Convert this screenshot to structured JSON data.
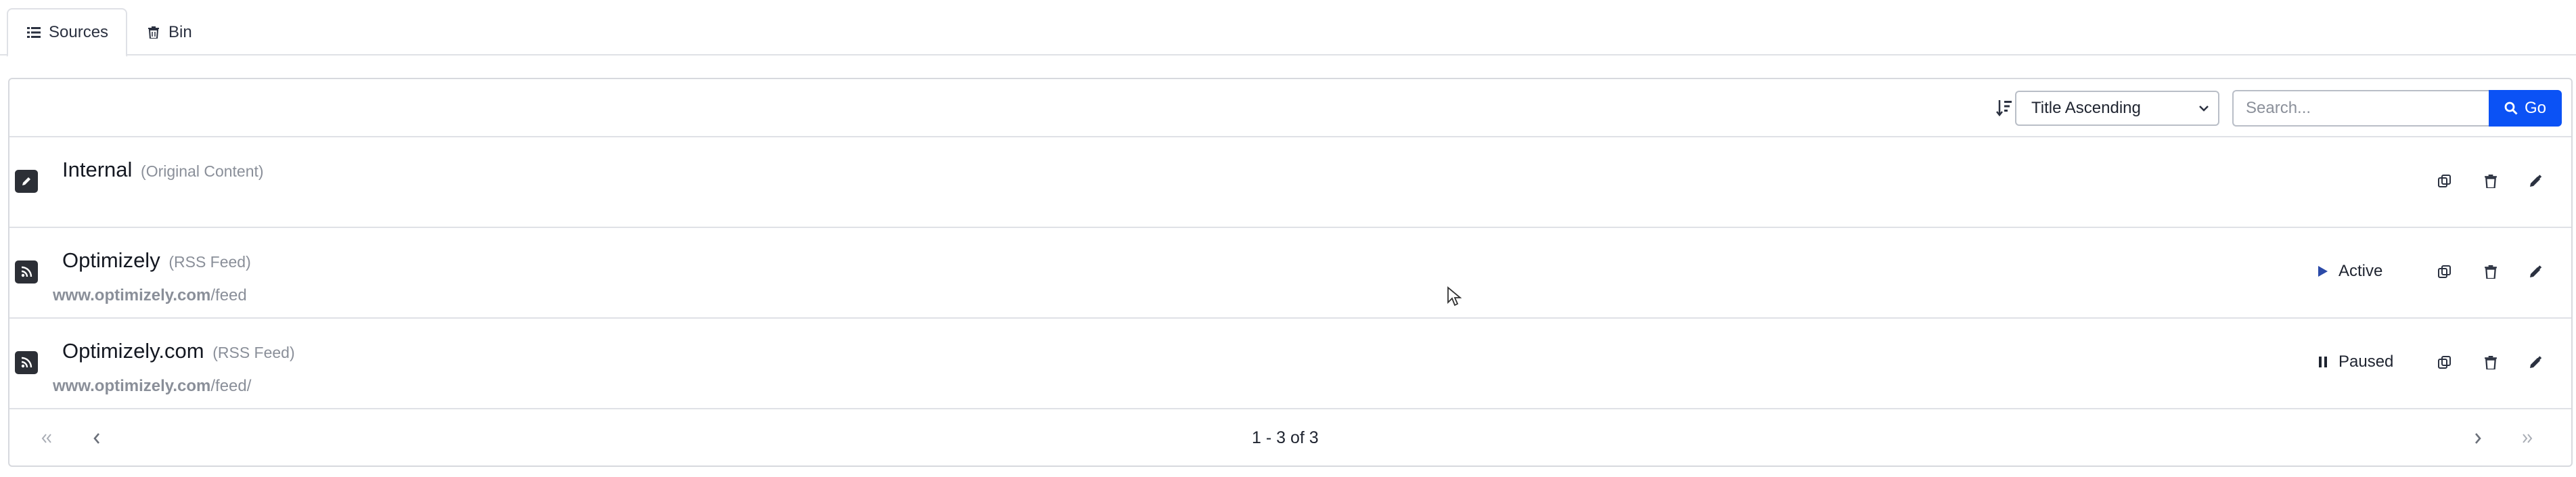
{
  "tabs": [
    {
      "label": "Sources",
      "icon": "list-icon",
      "active": true
    },
    {
      "label": "Bin",
      "icon": "trash-icon",
      "active": false
    }
  ],
  "toolbar": {
    "sort_icon": "sort-descending-icon",
    "sort_selected": "Title Ascending",
    "search_placeholder": "Search...",
    "search_value": "",
    "go_label": "Go",
    "go_icon": "search-icon",
    "accent_color": "#0b52f5"
  },
  "rows": [
    {
      "title": "Internal",
      "type": "(Original Content)",
      "type_icon": "pencil-icon",
      "url_host": "",
      "url_path": "",
      "status": ""
    },
    {
      "title": "Optimizely",
      "type": "(RSS Feed)",
      "type_icon": "rss-icon",
      "url_host": "www.optimizely.com",
      "url_path": "/feed",
      "status": "Active",
      "status_icon": "play-icon"
    },
    {
      "title": "Optimizely.com",
      "type": "(RSS Feed)",
      "type_icon": "rss-icon",
      "url_host": "www.optimizely.com",
      "url_path": "/feed/",
      "status": "Paused",
      "status_icon": "pause-icon"
    }
  ],
  "row_actions": [
    "copy-icon",
    "trash-icon",
    "pencil-icon"
  ],
  "pagination": {
    "info": "1 - 3 of 3"
  }
}
